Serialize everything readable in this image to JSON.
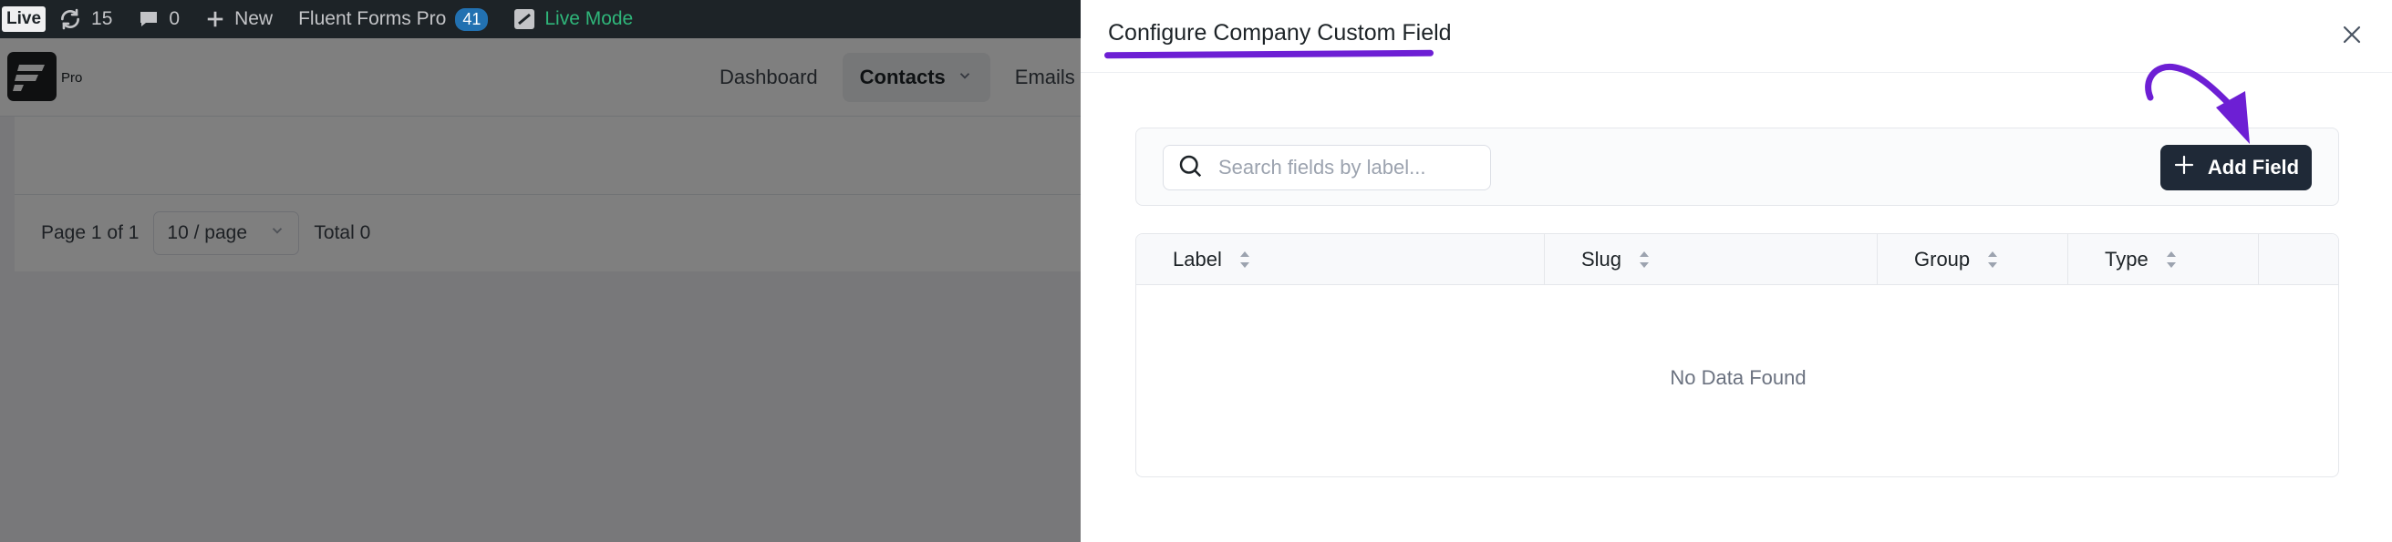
{
  "adminbar": {
    "live_badge": "Live",
    "updates_count": "15",
    "comments_count": "0",
    "new_label": "New",
    "plugin_name": "Fluent Forms Pro",
    "plugin_count": "41",
    "live_mode_label": "Live Mode"
  },
  "app": {
    "logo_suffix": "Pro",
    "nav": [
      {
        "label": "Dashboard"
      },
      {
        "label": "Contacts"
      },
      {
        "label": "Emails"
      }
    ],
    "pager": {
      "page_info": "Page 1 of 1",
      "page_size": "10 / page",
      "total": "Total 0"
    }
  },
  "drawer": {
    "title": "Configure Company Custom Field",
    "search_placeholder": "Search fields by label...",
    "add_button_label": "Add Field",
    "columns": [
      {
        "label": "Label"
      },
      {
        "label": "Slug"
      },
      {
        "label": "Group"
      },
      {
        "label": "Type"
      }
    ],
    "empty_text": "No Data Found"
  },
  "colors": {
    "annotation": "#6d1fd4",
    "primary_button": "#1f2937",
    "live_mode": "#2fb67a",
    "badge_blue": "#2271b1"
  }
}
